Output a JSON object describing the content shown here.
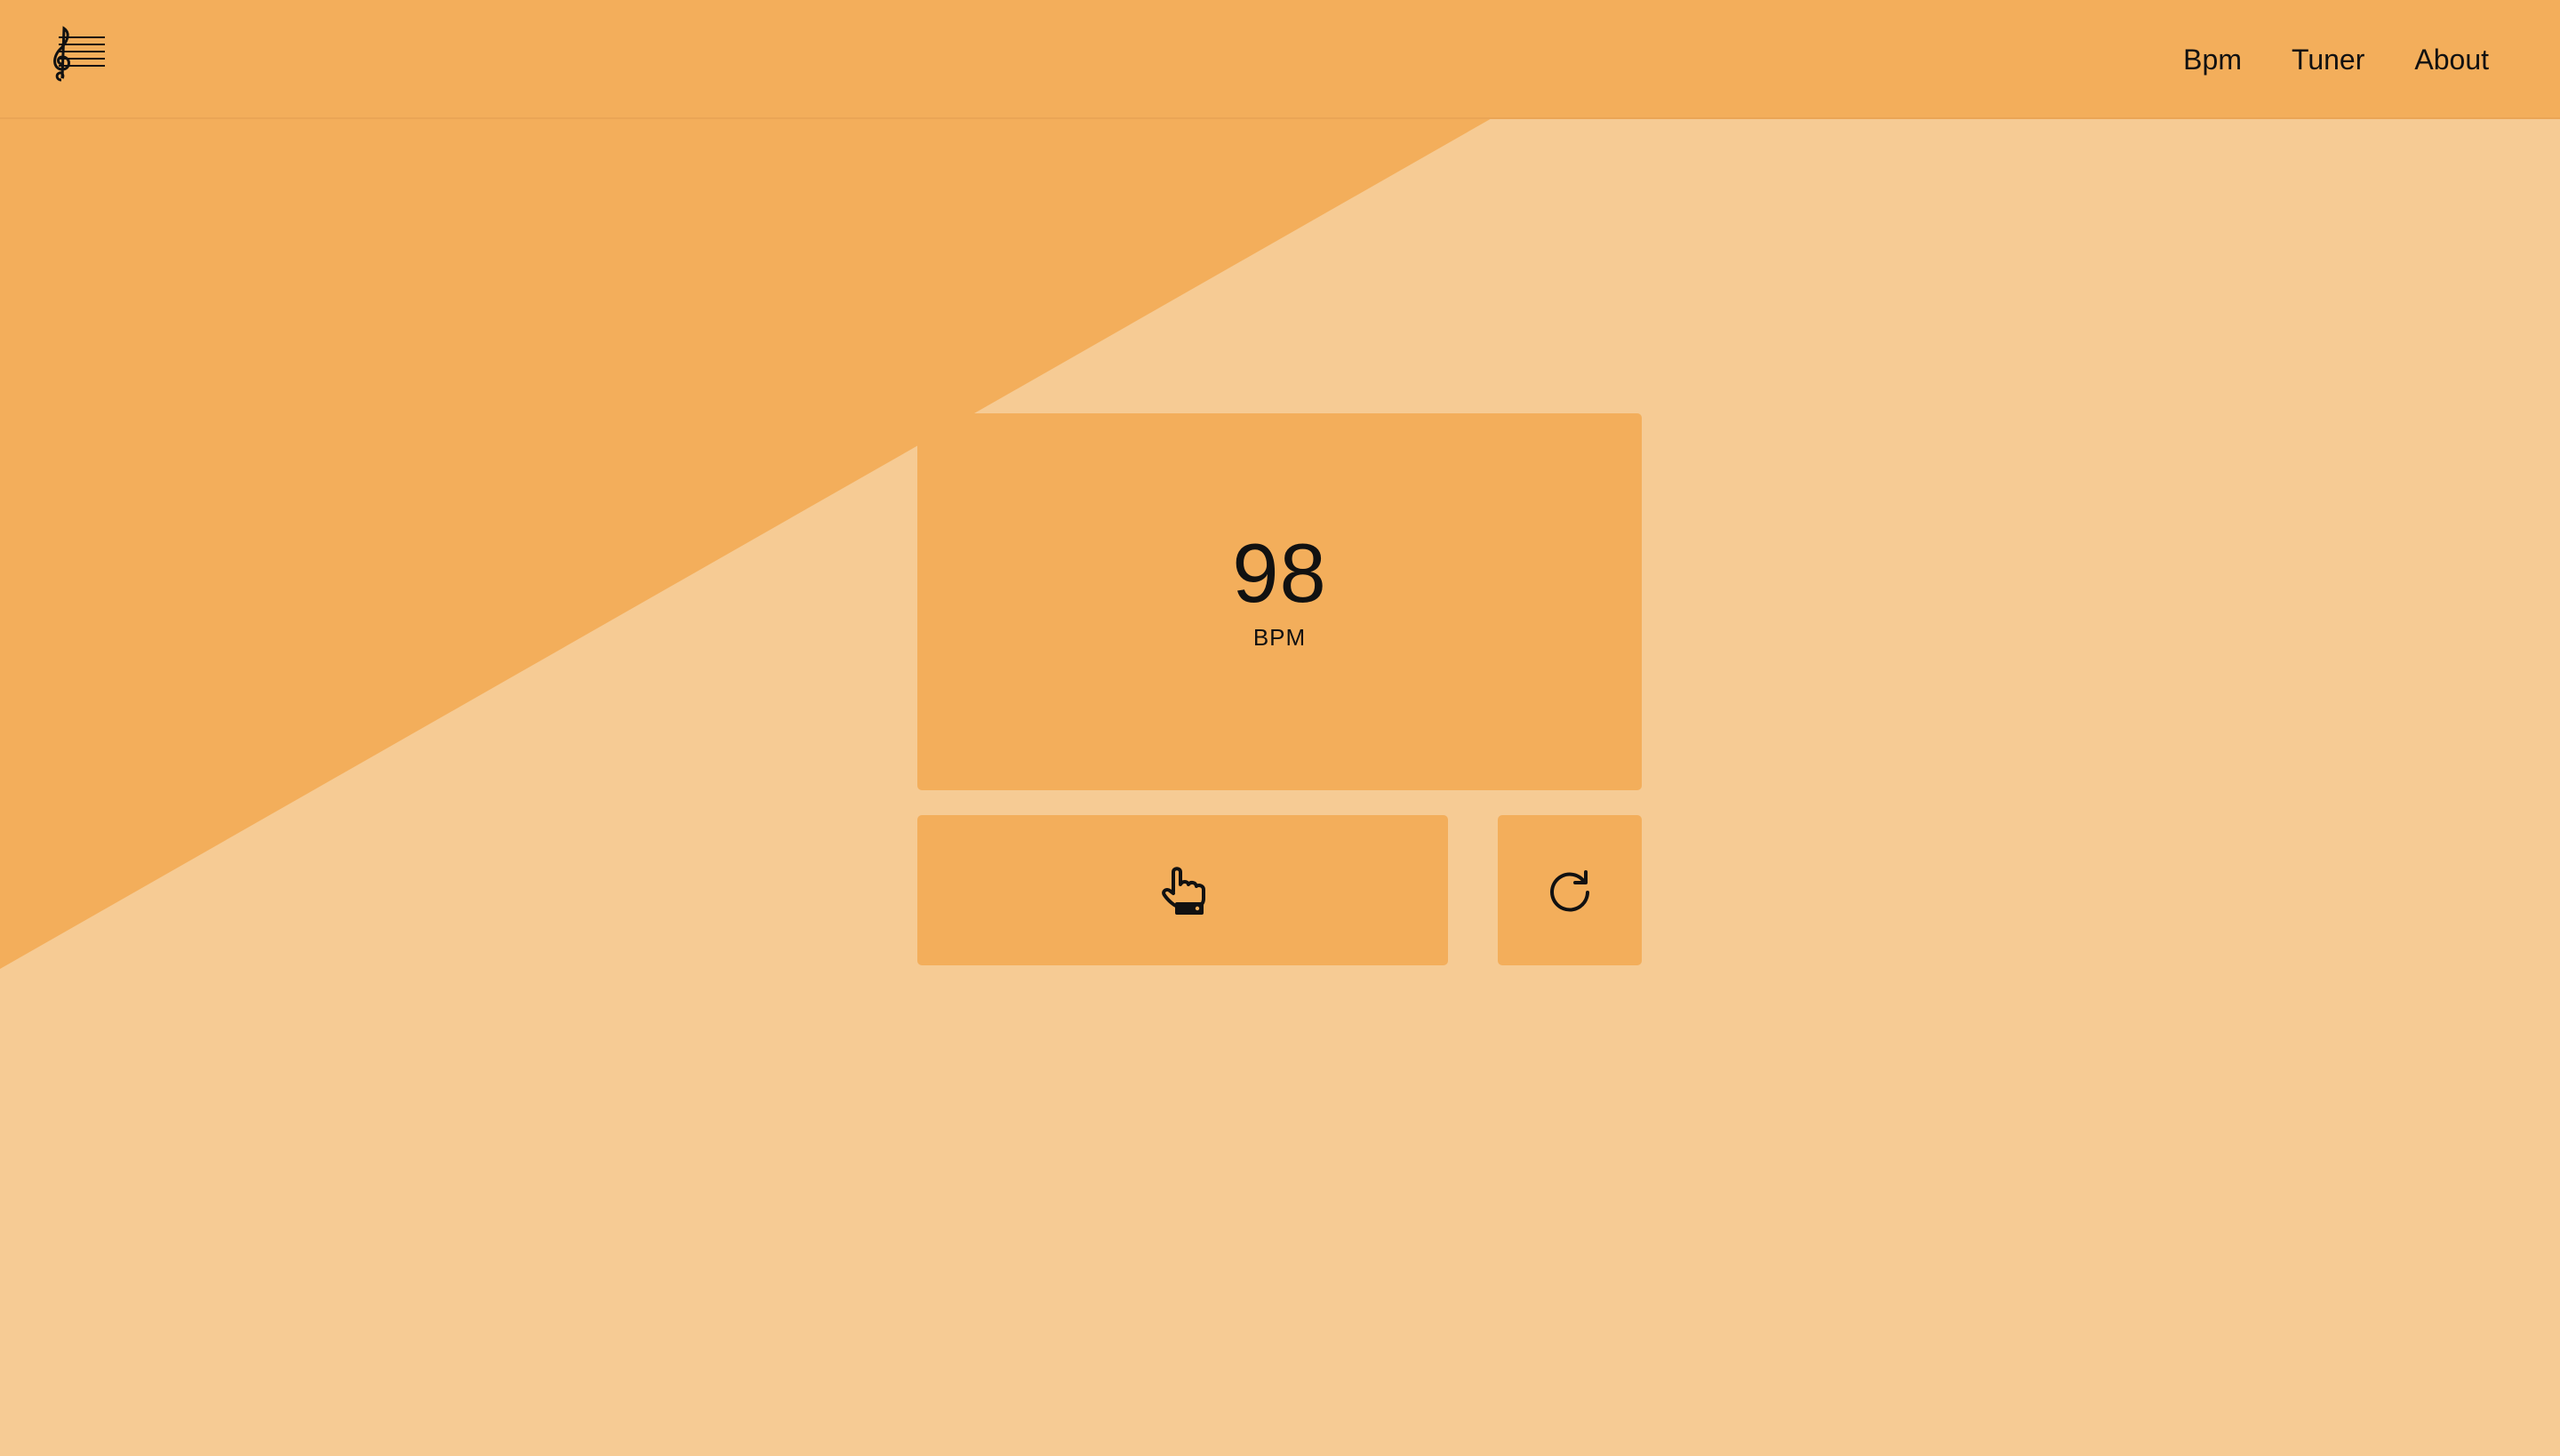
{
  "colors": {
    "page_background": "#f6cb94",
    "accent": "#f3ae5b",
    "text": "#111111"
  },
  "header": {
    "logo_icon": "treble-clef-staff-icon",
    "nav": [
      {
        "label": "Bpm"
      },
      {
        "label": "Tuner"
      },
      {
        "label": "About"
      }
    ]
  },
  "bpm_display": {
    "value": "98",
    "unit": "BPM"
  },
  "controls": {
    "tap_icon": "tap-hand-icon",
    "reset_icon": "reset-icon"
  }
}
